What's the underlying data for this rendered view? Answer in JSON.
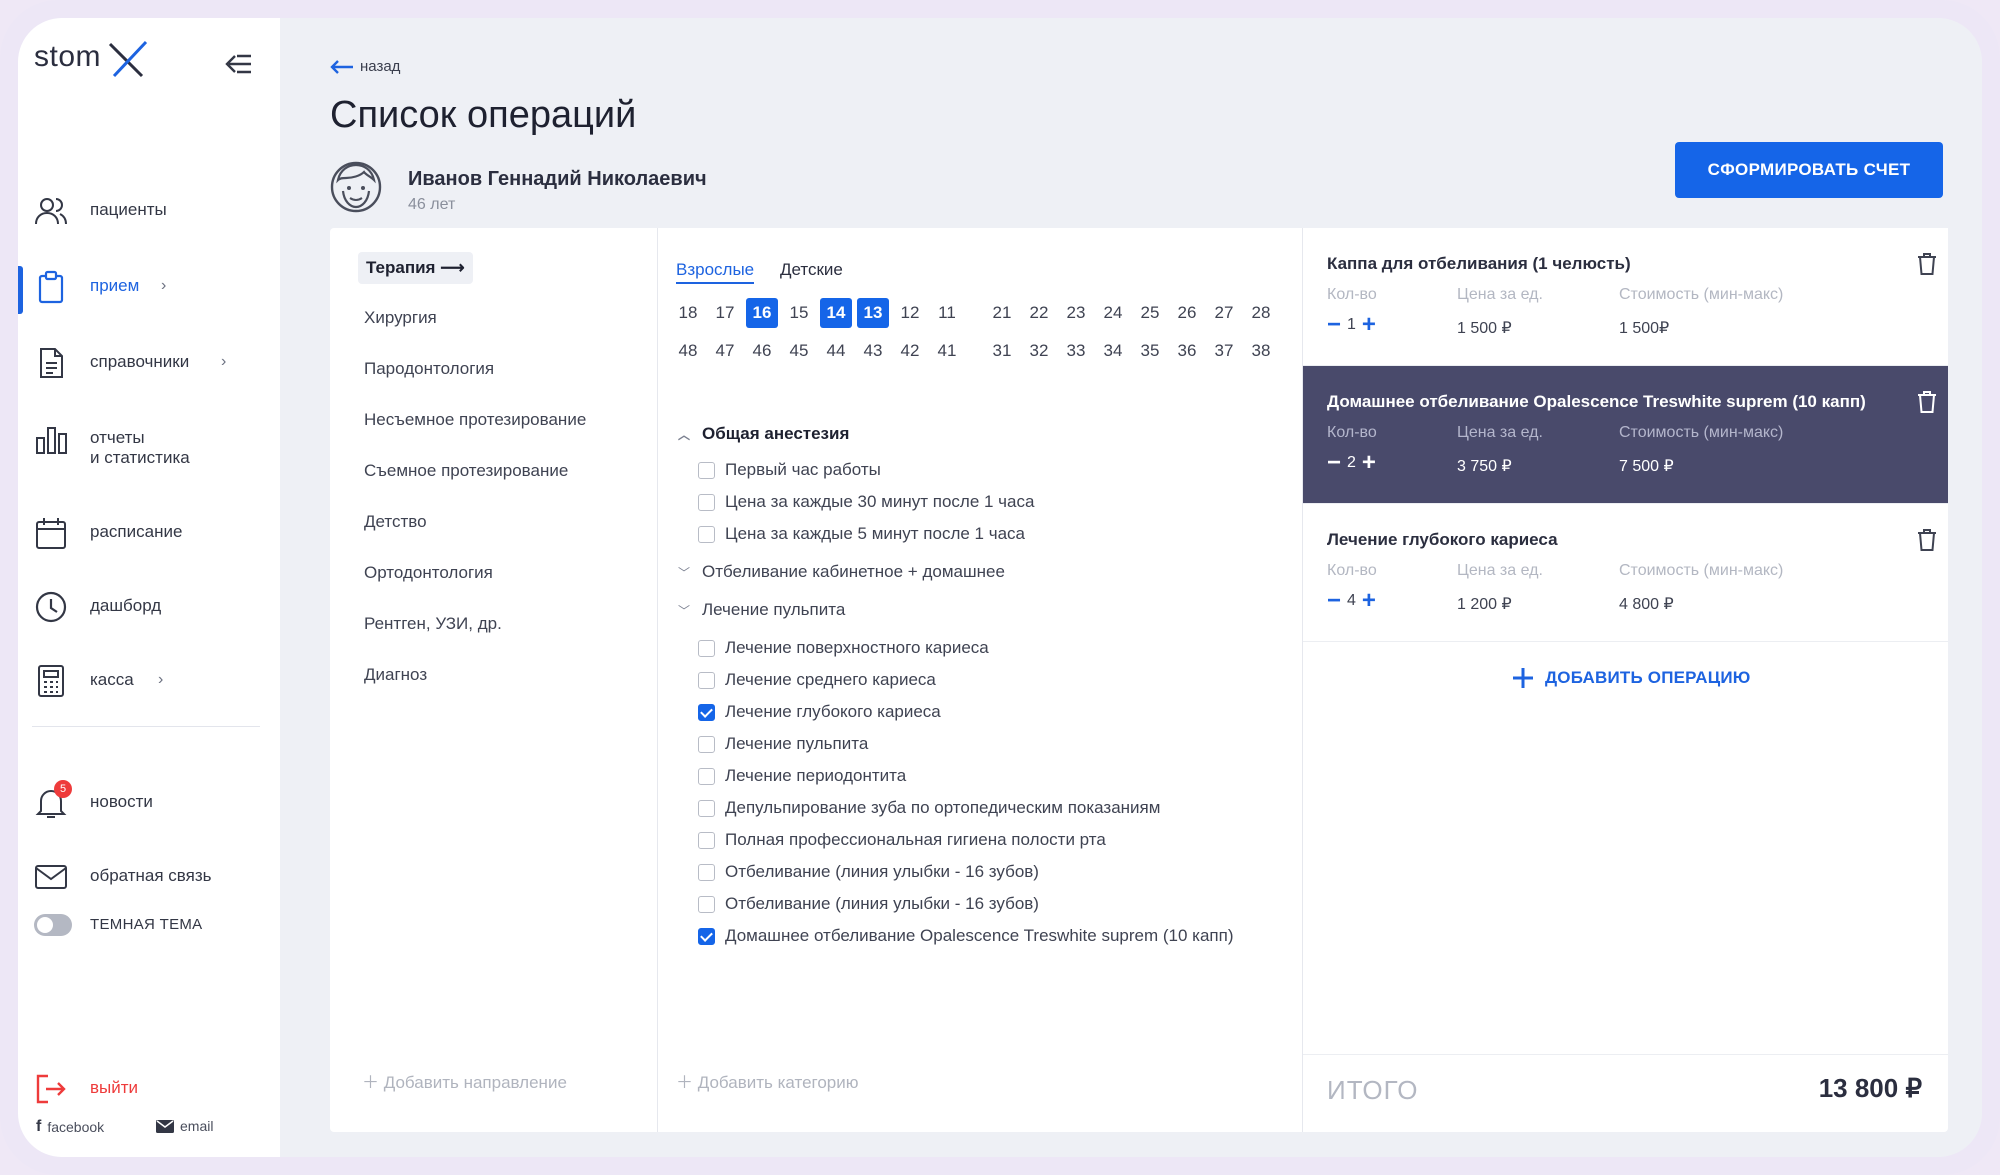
{
  "app": {
    "logo_text": "stom"
  },
  "sidebar": {
    "items": [
      {
        "label": "пациенты",
        "icon": "users-icon"
      },
      {
        "label": "прием",
        "icon": "clipboard-icon",
        "active": true
      },
      {
        "label": "справочники",
        "icon": "document-icon"
      },
      {
        "label_line1": "отчеты",
        "label_line2": "и статистика",
        "icon": "bar-chart-icon"
      },
      {
        "label": "расписание",
        "icon": "calendar-icon"
      },
      {
        "label": "дашборд",
        "icon": "clock-icon"
      },
      {
        "label": "касса",
        "icon": "calculator-icon"
      }
    ],
    "news": {
      "label": "новости",
      "badge": "5"
    },
    "feedback": {
      "label": "обратная связь"
    },
    "dark_theme": {
      "label": "ТЕМНАЯ ТЕМА"
    },
    "logout": {
      "label": "выйти"
    },
    "facebook": "facebook",
    "email": "email"
  },
  "header": {
    "back": "назад",
    "title": "Список операций",
    "patient_name": "Иванов Геннадий Николаевич",
    "patient_age": "46 лет",
    "invoice_button": "СФОРМИРОВАТЬ СЧЕТ"
  },
  "directions": {
    "items": [
      "Терапия",
      "Хирургия",
      "Пародонтология",
      "Несъемное протезирование",
      "Съемное протезирование",
      "Детство",
      "Ортодонтология",
      "Рентген, УЗИ, др.",
      "Диагноз"
    ],
    "add": "Добавить направление"
  },
  "operations": {
    "tabs": [
      "Взрослые",
      "Детские"
    ],
    "teeth_top": [
      "18",
      "17",
      "16",
      "15",
      "14",
      "13",
      "12",
      "11",
      "21",
      "22",
      "23",
      "24",
      "25",
      "26",
      "27",
      "28"
    ],
    "teeth_bottom": [
      "48",
      "47",
      "46",
      "45",
      "44",
      "43",
      "42",
      "41",
      "31",
      "32",
      "33",
      "34",
      "35",
      "36",
      "37",
      "38"
    ],
    "selected_teeth": [
      "16",
      "14",
      "13"
    ],
    "groups": [
      {
        "title": "Общая анестезия",
        "items": [
          {
            "label": "Первый час работы",
            "checked": false
          },
          {
            "label": "Цена за каждые 30 минут после 1 часа",
            "checked": false
          },
          {
            "label": "Цена за каждые 5 минут после 1 часа",
            "checked": false
          }
        ]
      },
      {
        "title": "Отбеливание кабинетное + домашнее"
      },
      {
        "title": "Лечение пульпита",
        "items": [
          {
            "label": "Лечение поверхностного кариеса",
            "checked": false
          },
          {
            "label": "Лечение среднего кариеса",
            "checked": false
          },
          {
            "label": "Лечение глубокого кариеса",
            "checked": true
          },
          {
            "label": "Лечение пульпита",
            "checked": false
          },
          {
            "label": "Лечение периодонтита",
            "checked": false
          },
          {
            "label": "Депульпирование зуба по ортопедическим показаниям",
            "checked": false
          },
          {
            "label": "Полная профессиональная гигиена полости рта",
            "checked": false
          },
          {
            "label": "Отбеливание (линия улыбки - 16 зубов)",
            "checked": false
          },
          {
            "label": "Отбеливание (линия улыбки - 16 зубов)",
            "checked": false
          },
          {
            "label": "Домашнее отбеливание Opalescence Treswhite suprem (10 капп)",
            "checked": true
          }
        ]
      }
    ],
    "add": "Добавить категорию"
  },
  "selected": {
    "headers": {
      "qty": "Кол-во",
      "price": "Цена за ед.",
      "cost": "Стоимость (мин-макс)"
    },
    "items": [
      {
        "title": "Каппа для отбеливания (1 челюсть)",
        "qty": "1",
        "price": "1 500 ₽",
        "cost": "1 500₽"
      },
      {
        "title": "Домашнее отбеливание Opalescence Treswhite suprem (10 капп)",
        "qty": "2",
        "price": "3 750 ₽",
        "cost": "7 500 ₽"
      },
      {
        "title": "Лечение глубокого кариеса",
        "qty": "4",
        "price": "1 200 ₽",
        "cost": "4 800 ₽"
      }
    ],
    "add": "ДОБАВИТЬ ОПЕРАЦИЮ",
    "total_label": "ИТОГО",
    "total_value": "13 800 ₽"
  },
  "colors": {
    "accent": "#1565e8",
    "highlight_card": "#494a6b",
    "danger": "#ee3b3b"
  }
}
